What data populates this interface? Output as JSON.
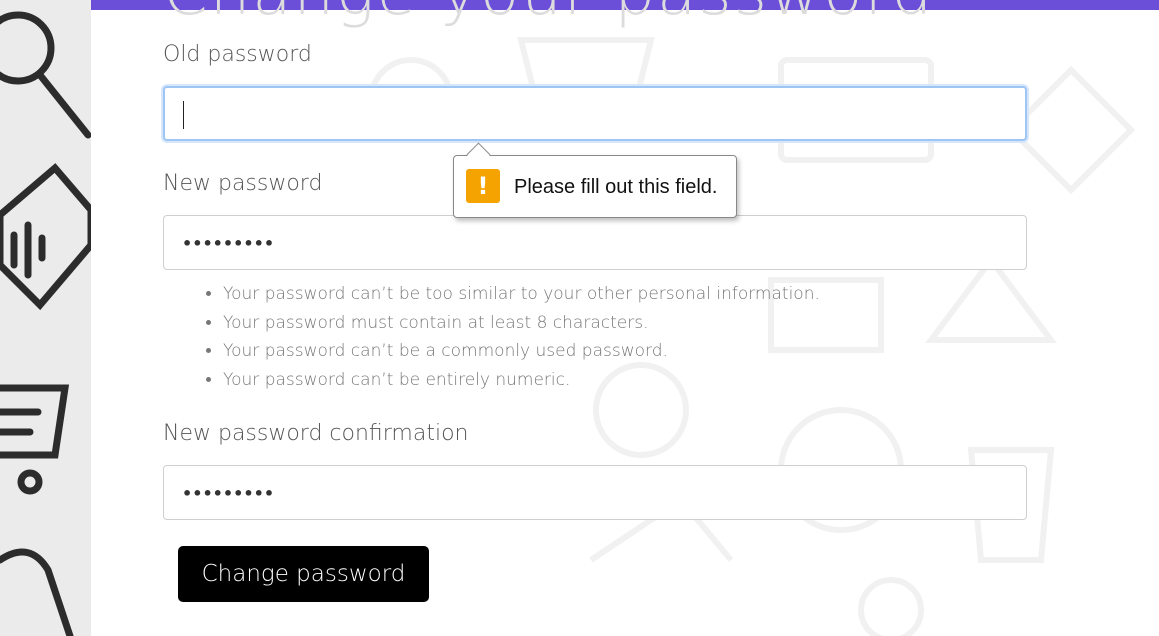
{
  "heading": "Change your password",
  "form": {
    "old_password": {
      "label": "Old password",
      "value": ""
    },
    "new_password": {
      "label": "New password",
      "value": "•••••••••"
    },
    "confirm_password": {
      "label": "New password confirmation",
      "value": "•••••••••"
    },
    "help_items": [
      "Your password can’t be too similar to your other personal information.",
      "Your password must contain at least 8 characters.",
      "Your password can’t be a commonly used password.",
      "Your password can’t be entirely numeric."
    ],
    "submit_label": "Change password"
  },
  "validation_tooltip": {
    "icon": "!",
    "message": "Please fill out this field."
  },
  "colors": {
    "accent_bar": "#6c4fd8",
    "warning": "#f5a300",
    "button": "#000000"
  }
}
